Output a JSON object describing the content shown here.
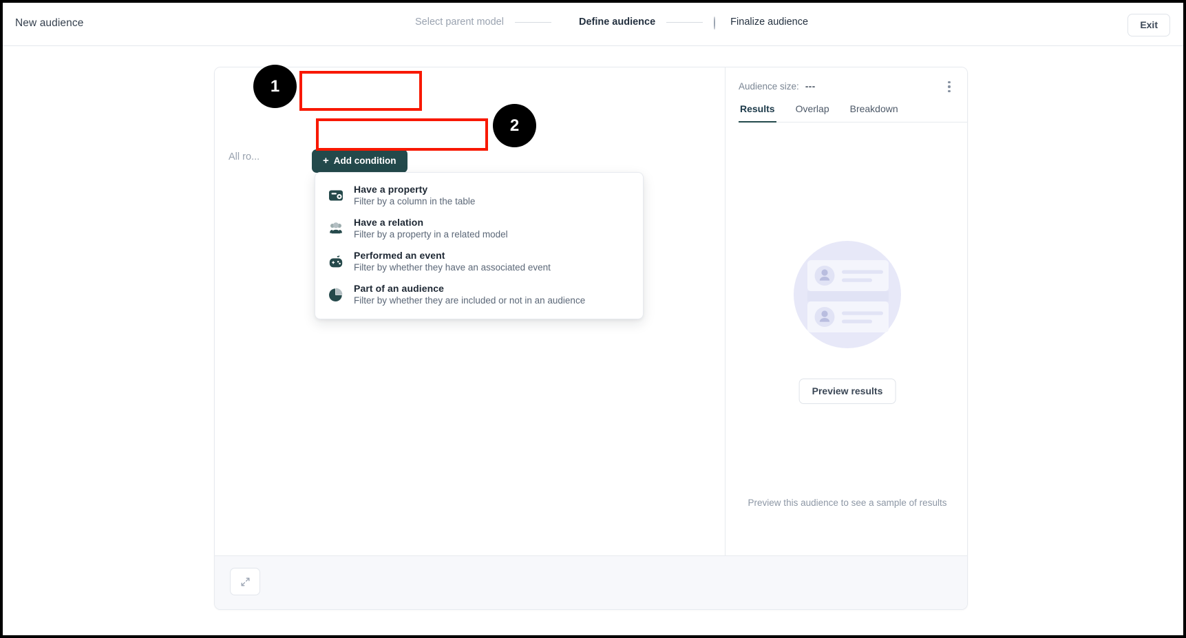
{
  "topbar": {
    "app_title": "New audience",
    "exit_label": "Exit",
    "steps": [
      {
        "label": "Select parent model",
        "state": "done",
        "marker": "check-circle-icon"
      },
      {
        "label": "Define audience",
        "state": "active",
        "marker": "filled-circle-icon"
      },
      {
        "label": "Finalize audience",
        "state": "todo",
        "marker": "empty-circle-icon"
      }
    ]
  },
  "builder": {
    "all_rows_text": "All ro...",
    "add_condition_label": "Add condition",
    "add_condition_plus": "+",
    "menu_items": [
      {
        "title": "Have a property",
        "desc": "Filter by a column in the table",
        "icon": "wallet-icon"
      },
      {
        "title": "Have a relation",
        "desc": "Filter by a property in a related model",
        "icon": "people-icon"
      },
      {
        "title": "Performed an event",
        "desc": "Filter by whether they have an associated event",
        "icon": "game-controller-icon"
      },
      {
        "title": "Part of an audience",
        "desc": "Filter by whether they are included or not in an audience",
        "icon": "pie-chart-icon"
      }
    ]
  },
  "results_panel": {
    "audience_size_label": "Audience size:",
    "audience_size_value": "---",
    "tabs": [
      {
        "label": "Results",
        "active": true
      },
      {
        "label": "Overlap",
        "active": false
      },
      {
        "label": "Breakdown",
        "active": false
      }
    ],
    "preview_button_label": "Preview results",
    "preview_hint": "Preview this audience to see a sample of results",
    "kebab_icon": "more-vertical-icon",
    "empty_illustration_icon": "audience-placeholder-illustration"
  },
  "footer": {
    "expand_icon": "expand-diagonal-icon"
  },
  "annotations": [
    {
      "badge": "1",
      "target": "add-condition-button"
    },
    {
      "badge": "2",
      "target": "have-a-property-menu-item"
    }
  ],
  "colors": {
    "accent_dark_teal": "#23494b",
    "step_active": "#1d1f4e",
    "annotation_red": "#f81800",
    "illustration_purple": "#e6e7f8"
  }
}
